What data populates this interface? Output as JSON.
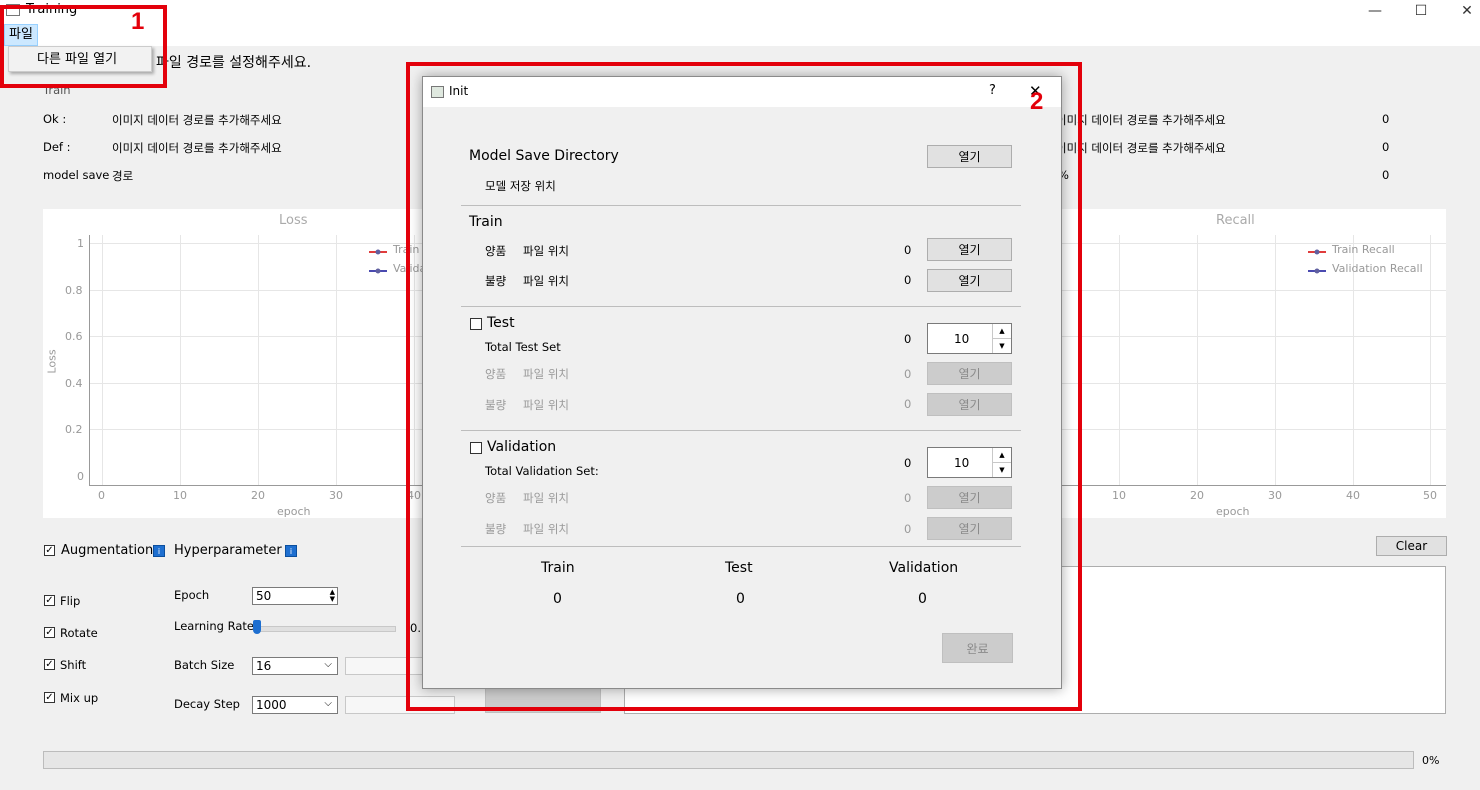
{
  "window": {
    "title": "Training",
    "minimize": "—",
    "maximize": "☐",
    "close": "✕"
  },
  "menu": {
    "file": "파일",
    "open_other": "다른 파일 열기",
    "path_hint_fragment": "파일 경로를 설정해주세요."
  },
  "main": {
    "train_label": "Train",
    "rows_left": [
      {
        "label": "Ok :",
        "value": "이미지 데이터 경로를 추가해주세요"
      },
      {
        "label": "Def :",
        "value": "이미지 데이터 경로를 추가해주세요"
      },
      {
        "label": "model save",
        "value": "경로"
      }
    ],
    "rows_right": [
      {
        "value": "이미지 데이터 경로를 추가해주세요",
        "count": "0"
      },
      {
        "value": "이미지 데이터 경로를 추가해주세요",
        "count": "0"
      },
      {
        "value": "%",
        "count": "0"
      }
    ]
  },
  "loss_chart": {
    "title": "Loss",
    "xlabel": "epoch",
    "ylabel": "Loss",
    "y_ticks": [
      "1",
      "0.8",
      "0.6",
      "0.4",
      "0.2",
      "0"
    ],
    "x_ticks": [
      "0",
      "10",
      "20",
      "30",
      "40"
    ],
    "legend": [
      "Train L",
      "Valida"
    ]
  },
  "recall_chart": {
    "title": "Recall",
    "xlabel": "epoch",
    "x_ticks": [
      "10",
      "20",
      "30",
      "40",
      "50"
    ],
    "legend": [
      "Train Recall",
      "Validation Recall"
    ]
  },
  "options": {
    "augmentation": "Augmentation",
    "hyperparameter": "Hyperparameter",
    "info": "i",
    "flip": "Flip",
    "rotate": "Rotate",
    "shift": "Shift",
    "mixup": "Mix up",
    "epoch_label": "Epoch",
    "epoch_value": "50",
    "lr_label": "Learning Rate",
    "lr_value_fragment": "0.(",
    "batch_label": "Batch Size",
    "batch_value": "16",
    "decay_label": "Decay Step",
    "decay_value": "1000",
    "clear": "Clear",
    "progress_text": "0%"
  },
  "dialog": {
    "title": "Init",
    "help": "?",
    "close": "✕",
    "model_save_dir": "Model Save Directory",
    "model_save_sub": "모델 저장 위치",
    "open": "열기",
    "train_heading": "Train",
    "good_label": "양품",
    "bad_label": "불량",
    "file_location": "파일 위치",
    "train_good_count": "0",
    "train_bad_count": "0",
    "test_heading": "Test",
    "total_test": "Total Test Set",
    "test_count": "0",
    "test_spin": "10",
    "test_good_count": "0",
    "test_bad_count": "0",
    "val_heading": "Validation",
    "total_val": "Total Validation Set:",
    "val_count": "0",
    "val_spin": "10",
    "val_good_count": "0",
    "val_bad_count": "0",
    "summary_train": "Train",
    "summary_test": "Test",
    "summary_val": "Validation",
    "sum_train_val": "0",
    "sum_test_val": "0",
    "sum_val_val": "0",
    "done": "완료"
  },
  "annotations": {
    "one": "1",
    "two": "2"
  },
  "colors": {
    "annotation_red": "#e3000b",
    "train_series": "#e03c3c",
    "val_series": "#4a4ab0",
    "info_blue": "#1e6fd0"
  }
}
